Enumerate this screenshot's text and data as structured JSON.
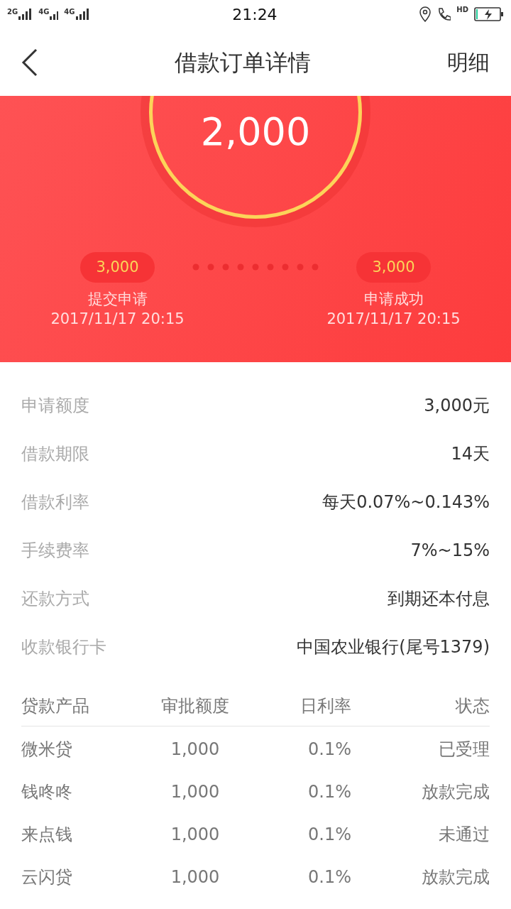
{
  "status_bar": {
    "networks": [
      "2G",
      "4G",
      "4G"
    ],
    "time": "21:24",
    "call_label": "HD"
  },
  "header": {
    "title": "借款订单详情",
    "action": "明细"
  },
  "summary": {
    "amount": "2,000",
    "steps": [
      {
        "amount": "3,000",
        "label": "提交申请",
        "time": "2017/11/17 20:15"
      },
      {
        "amount": "3,000",
        "label": "申请成功",
        "time": "2017/11/17 20:15"
      }
    ]
  },
  "details": [
    {
      "label": "申请额度",
      "value": "3,000元"
    },
    {
      "label": "借款期限",
      "value": "14天"
    },
    {
      "label": "借款利率",
      "value": "每天0.07%~0.143%"
    },
    {
      "label": "手续费率",
      "value": "7%~15%"
    },
    {
      "label": "还款方式",
      "value": "到期还本付息"
    },
    {
      "label": "收款银行卡",
      "value": "中国农业银行(尾号1379)"
    }
  ],
  "table": {
    "columns": [
      "贷款产品",
      "审批额度",
      "日利率",
      "状态"
    ],
    "rows": [
      [
        "微米贷",
        "1,000",
        "0.1%",
        "已受理"
      ],
      [
        "钱咚咚",
        "1,000",
        "0.1%",
        "放款完成"
      ],
      [
        "来点钱",
        "1,000",
        "0.1%",
        "未通过"
      ],
      [
        "云闪贷",
        "1,000",
        "0.1%",
        "放款完成"
      ]
    ]
  }
}
